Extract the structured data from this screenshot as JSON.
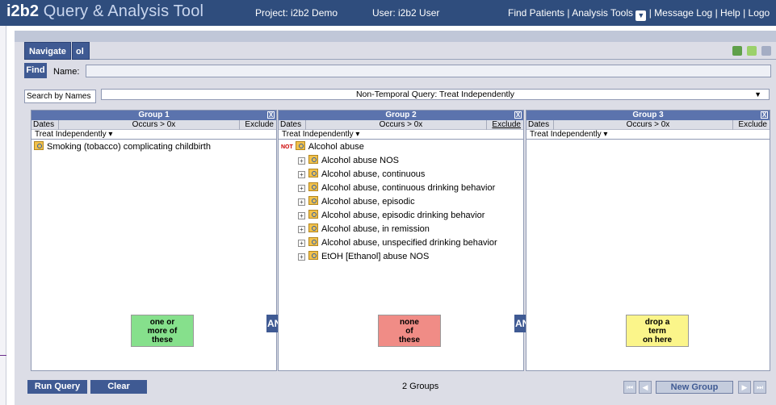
{
  "header": {
    "brand_bold": "i2b2",
    "brand_rest": " Query & Analysis Tool",
    "project": "Project: i2b2 Demo",
    "user": "User: i2b2 User",
    "menu_find": "Find Patients",
    "menu_analysis": "Analysis Tools",
    "menu_message": "Message Log",
    "menu_help": "Help",
    "menu_logout": "Logo",
    "separator": "|"
  },
  "nav": {
    "tab_navigate": "Navigate",
    "tab_tool": "ol"
  },
  "find": {
    "button": "Find",
    "name_label": "Name:",
    "name_value": ""
  },
  "search": {
    "tab": "Search by Names",
    "query_type": "Non-Temporal Query: Treat Independently",
    "dropdown_icon": "▼"
  },
  "groups": [
    {
      "title": "Group 1",
      "close": "X",
      "dates": "Dates",
      "occurs": "Occurs > 0x",
      "exclude": "Exclude",
      "treat": "Treat Independently ▾",
      "items": [
        {
          "label": "Smoking (tobacco) complicating childbirth"
        }
      ],
      "hint": [
        "one or",
        "more of",
        "these"
      ],
      "hint_color": "#86e08c"
    },
    {
      "title": "Group 2",
      "close": "X",
      "dates": "Dates",
      "occurs": "Occurs > 0x",
      "exclude": "Exclude",
      "treat": "Treat Independently ▾",
      "not_tag": "NOT",
      "parent": "Alcohol abuse",
      "children": [
        {
          "label": "Alcohol abuse NOS"
        },
        {
          "label": "Alcohol abuse, continuous"
        },
        {
          "label": "Alcohol abuse, continuous drinking behavior"
        },
        {
          "label": "Alcohol abuse, episodic"
        },
        {
          "label": "Alcohol abuse, episodic drinking behavior"
        },
        {
          "label": "Alcohol abuse, in remission"
        },
        {
          "label": "Alcohol abuse, unspecified drinking behavior"
        },
        {
          "label": "EtOH [Ethanol] abuse NOS"
        }
      ],
      "hint": [
        "none",
        "of",
        "these"
      ],
      "hint_color": "#f08c86"
    },
    {
      "title": "Group 3",
      "close": "X",
      "dates": "Dates",
      "occurs": "Occurs > 0x",
      "exclude": "Exclude",
      "treat": "Treat Independently ▾",
      "hint": [
        "drop a",
        "term",
        "on here"
      ],
      "hint_color": "#fbf58a"
    }
  ],
  "connectors": [
    "AND",
    "AND"
  ],
  "bottom": {
    "run_query": "Run Query",
    "clear": "Clear",
    "groups_count": "2 Groups",
    "new_group": "New Group",
    "first": "⏮",
    "prev": "◀",
    "next": "▶",
    "last": "⏭"
  },
  "colors": {
    "header_bg": "#2f4d7d",
    "accent": "#3f5a93",
    "group_header": "#5b73ad"
  }
}
